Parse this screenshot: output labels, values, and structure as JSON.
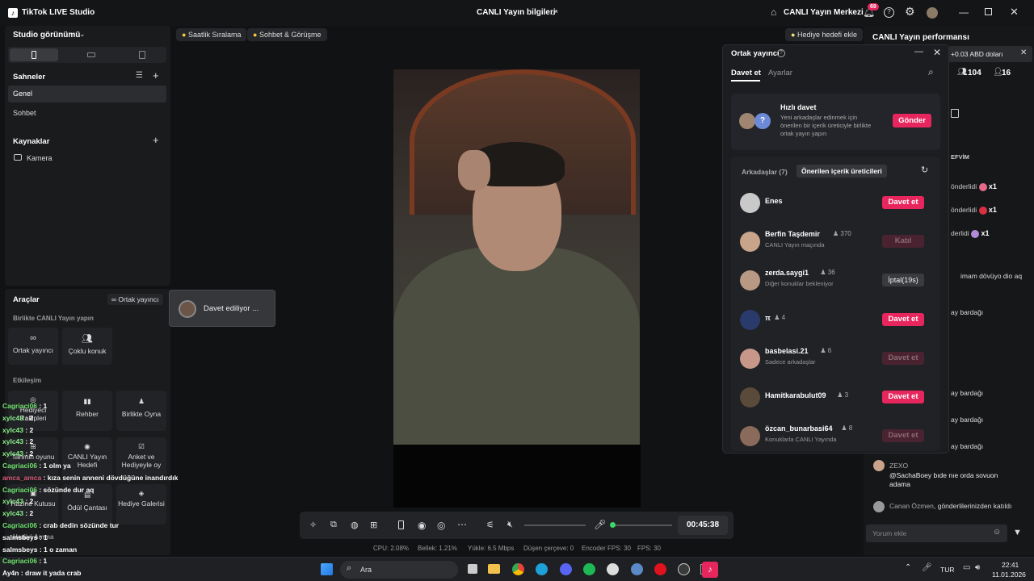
{
  "app": {
    "title": "TikTok LIVE Studio"
  },
  "header": {
    "live_info": "CANLI Yayın bilgileri",
    "center": "CANLI Yayın Merkezi",
    "notif_count": "69"
  },
  "studio": {
    "view_label": "Studio görünümü"
  },
  "scenes": {
    "title": "Sahneler",
    "items": [
      "Genel",
      "Sohbet"
    ]
  },
  "sources": {
    "title": "Kaynaklar",
    "items": [
      "Kamera"
    ]
  },
  "tools": {
    "title": "Araçlar",
    "co_host_chip": "Ortak yayıncı",
    "together_title": "Birlikte CANLI Yayın yapın",
    "together": [
      "Ortak yayıncı",
      "Çoklu konuk"
    ],
    "engagement_title": "Etkileşim",
    "engagement": [
      "Hediyeci Rakipleri",
      "Rehber",
      "Birlikte Oyna",
      "Tahmin oyunu",
      "CANLI Yayın Hedefi",
      "Anket ve Hediyeyle oy",
      "Hazine Kutusu",
      "Ödül Çantası",
      "Hediye Galerisi"
    ],
    "bottom_label": "Hediyi Amma"
  },
  "invite_popup": {
    "text": "Davet ediliyor ..."
  },
  "top_chips": [
    "Saatlik Sıralama",
    "Sohbet & Görüşme"
  ],
  "gift_goal": "Hediye hedefi ekle",
  "cohost": {
    "title": "Ortak yayıncı",
    "tabs": [
      "Davet et",
      "Ayarlar"
    ],
    "quick": {
      "title": "Hızlı davet",
      "desc": "Yeni arkadaşlar edinmek için önerilen bir içerik üreticiyle birlikte ortak yayın yapın",
      "button": "Gönder"
    },
    "list_tabs": [
      "Arkadaşlar (7)",
      "Önerilen içerik üreticileri"
    ],
    "users": [
      {
        "name": "Enes",
        "count": "",
        "sub": "",
        "action": "Davet et",
        "state": "active",
        "color": "#c9c9c9"
      },
      {
        "name": "Berfin Taşdemir",
        "count": "370",
        "sub": "CANLI Yayın maçında",
        "action": "Katıl",
        "state": "dim",
        "color": "#c8a48a"
      },
      {
        "name": "zerda.saygi1",
        "count": "36",
        "sub": "Diğer konuklar bekleniyor",
        "action": "İptal(19s)",
        "state": "gray",
        "color": "#b89a84"
      },
      {
        "name": "π",
        "count": "4",
        "sub": "",
        "action": "Davet et",
        "state": "active",
        "color": "#2a3a6a"
      },
      {
        "name": "basbelasi.21",
        "count": "6",
        "sub": "Sadece arkadaşlar",
        "action": "Davet et",
        "state": "dim",
        "color": "#c7988a"
      },
      {
        "name": "Hamitkarabulut09",
        "count": "3",
        "sub": "",
        "action": "Davet et",
        "state": "active",
        "color": "#5a4a3a"
      },
      {
        "name": "özcan_bunarbasi64",
        "count": "8",
        "sub": "Konuklarla CANLI Yayında",
        "action": "Davet et",
        "state": "dim",
        "color": "#8a6a5a"
      }
    ]
  },
  "controls": {
    "timer": "00:45:38"
  },
  "stats": {
    "cpu": "CPU: 2.08%",
    "mem": "Bellek: 1.21%",
    "upload": "Yükle: 6.5 Mbps",
    "dropped": "Düşen çerçeve: 0",
    "encoder": "Encoder FPS: 30",
    "fps": "FPS: 30"
  },
  "performance": {
    "title": "CANLI Yayın performansı",
    "earn": "+0.03 ABD doları",
    "viewers": "104",
    "likes": "16",
    "section_fragment": "EFVİM",
    "gift_rows": [
      {
        "text": "önderlidi",
        "count": "x1",
        "color": "#e66a8a"
      },
      {
        "text": "önderlidi",
        "count": "x1",
        "color": "#d83040"
      },
      {
        "text": "derlidi",
        "count": "x1",
        "color": "#b38ad8"
      }
    ],
    "feed_fragments": [
      "imam dövüyo dio aq",
      "ay bardağı",
      "ay bardağı",
      "ay bardağı",
      "ay bardağı"
    ],
    "comment": {
      "user": "ZEXO",
      "text": "@SachaBoey bıde nıe orda sovuon adama"
    },
    "join": {
      "user": "Canan Özmen",
      "text": ", gönderlilerinizden katıldı"
    },
    "input_placeholder": "Yorum ekle"
  },
  "overlay_chat": [
    {
      "user": "Cagriaci06",
      "text": " : 1",
      "color": "#6ee36e"
    },
    {
      "user": "xylc43",
      "text": " : 2",
      "color": "#8af28a"
    },
    {
      "user": "xylc43",
      "text": " : 2",
      "color": "#8af28a"
    },
    {
      "user": "xylc43",
      "text": " : 2",
      "color": "#8af28a"
    },
    {
      "user": "xylc43",
      "text": " : 2",
      "color": "#8af28a"
    },
    {
      "user": "Cagriaci06",
      "text": " : 1 olm ya",
      "color": "#6ee36e"
    },
    {
      "user": "amca_amca",
      "text": " : kıza senin anneni dövdüğüne inandırdık",
      "color": "#d85a7a"
    },
    {
      "user": "Cagriaci06",
      "text": " : sözünde dur aq",
      "color": "#6ee36e"
    },
    {
      "user": "xylc43",
      "text": " : 2",
      "color": "#8af28a"
    },
    {
      "user": "xylc43",
      "text": " : 2",
      "color": "#8af28a"
    },
    {
      "user": "Cagriaci06",
      "text": " : crab dedin sözünde tur",
      "color": "#6ee36e"
    },
    {
      "user": "salmsbeys",
      "text": " : 1",
      "color": "#ffffff"
    },
    {
      "user": "salmsbeys",
      "text": " : 1 o zaman",
      "color": "#ffffff"
    },
    {
      "user": "Cagriaci06",
      "text": " : 1",
      "color": "#6ee36e"
    },
    {
      "user": "Ay4n",
      "text": " : draw it yada crab",
      "color": "#ffffff"
    }
  ],
  "taskbar": {
    "search": "Ara",
    "lang": "TUR",
    "time": "22:41",
    "date": "11.01.2026"
  }
}
